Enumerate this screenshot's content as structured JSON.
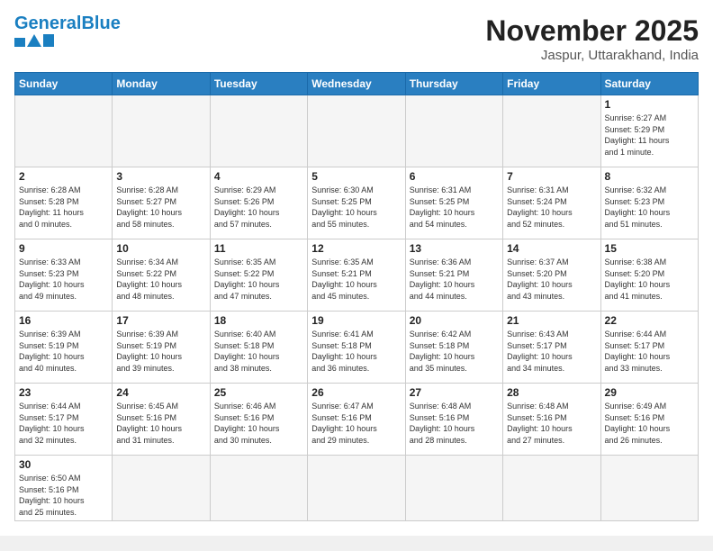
{
  "header": {
    "logo_general": "General",
    "logo_blue": "Blue",
    "title": "November 2025",
    "location": "Jaspur, Uttarakhand, India"
  },
  "weekdays": [
    "Sunday",
    "Monday",
    "Tuesday",
    "Wednesday",
    "Thursday",
    "Friday",
    "Saturday"
  ],
  "days": [
    {
      "num": "",
      "info": ""
    },
    {
      "num": "",
      "info": ""
    },
    {
      "num": "",
      "info": ""
    },
    {
      "num": "",
      "info": ""
    },
    {
      "num": "",
      "info": ""
    },
    {
      "num": "",
      "info": ""
    },
    {
      "num": "1",
      "info": "Sunrise: 6:27 AM\nSunset: 5:29 PM\nDaylight: 11 hours\nand 1 minute."
    },
    {
      "num": "2",
      "info": "Sunrise: 6:28 AM\nSunset: 5:28 PM\nDaylight: 11 hours\nand 0 minutes."
    },
    {
      "num": "3",
      "info": "Sunrise: 6:28 AM\nSunset: 5:27 PM\nDaylight: 10 hours\nand 58 minutes."
    },
    {
      "num": "4",
      "info": "Sunrise: 6:29 AM\nSunset: 5:26 PM\nDaylight: 10 hours\nand 57 minutes."
    },
    {
      "num": "5",
      "info": "Sunrise: 6:30 AM\nSunset: 5:25 PM\nDaylight: 10 hours\nand 55 minutes."
    },
    {
      "num": "6",
      "info": "Sunrise: 6:31 AM\nSunset: 5:25 PM\nDaylight: 10 hours\nand 54 minutes."
    },
    {
      "num": "7",
      "info": "Sunrise: 6:31 AM\nSunset: 5:24 PM\nDaylight: 10 hours\nand 52 minutes."
    },
    {
      "num": "8",
      "info": "Sunrise: 6:32 AM\nSunset: 5:23 PM\nDaylight: 10 hours\nand 51 minutes."
    },
    {
      "num": "9",
      "info": "Sunrise: 6:33 AM\nSunset: 5:23 PM\nDaylight: 10 hours\nand 49 minutes."
    },
    {
      "num": "10",
      "info": "Sunrise: 6:34 AM\nSunset: 5:22 PM\nDaylight: 10 hours\nand 48 minutes."
    },
    {
      "num": "11",
      "info": "Sunrise: 6:35 AM\nSunset: 5:22 PM\nDaylight: 10 hours\nand 47 minutes."
    },
    {
      "num": "12",
      "info": "Sunrise: 6:35 AM\nSunset: 5:21 PM\nDaylight: 10 hours\nand 45 minutes."
    },
    {
      "num": "13",
      "info": "Sunrise: 6:36 AM\nSunset: 5:21 PM\nDaylight: 10 hours\nand 44 minutes."
    },
    {
      "num": "14",
      "info": "Sunrise: 6:37 AM\nSunset: 5:20 PM\nDaylight: 10 hours\nand 43 minutes."
    },
    {
      "num": "15",
      "info": "Sunrise: 6:38 AM\nSunset: 5:20 PM\nDaylight: 10 hours\nand 41 minutes."
    },
    {
      "num": "16",
      "info": "Sunrise: 6:39 AM\nSunset: 5:19 PM\nDaylight: 10 hours\nand 40 minutes."
    },
    {
      "num": "17",
      "info": "Sunrise: 6:39 AM\nSunset: 5:19 PM\nDaylight: 10 hours\nand 39 minutes."
    },
    {
      "num": "18",
      "info": "Sunrise: 6:40 AM\nSunset: 5:18 PM\nDaylight: 10 hours\nand 38 minutes."
    },
    {
      "num": "19",
      "info": "Sunrise: 6:41 AM\nSunset: 5:18 PM\nDaylight: 10 hours\nand 36 minutes."
    },
    {
      "num": "20",
      "info": "Sunrise: 6:42 AM\nSunset: 5:18 PM\nDaylight: 10 hours\nand 35 minutes."
    },
    {
      "num": "21",
      "info": "Sunrise: 6:43 AM\nSunset: 5:17 PM\nDaylight: 10 hours\nand 34 minutes."
    },
    {
      "num": "22",
      "info": "Sunrise: 6:44 AM\nSunset: 5:17 PM\nDaylight: 10 hours\nand 33 minutes."
    },
    {
      "num": "23",
      "info": "Sunrise: 6:44 AM\nSunset: 5:17 PM\nDaylight: 10 hours\nand 32 minutes."
    },
    {
      "num": "24",
      "info": "Sunrise: 6:45 AM\nSunset: 5:16 PM\nDaylight: 10 hours\nand 31 minutes."
    },
    {
      "num": "25",
      "info": "Sunrise: 6:46 AM\nSunset: 5:16 PM\nDaylight: 10 hours\nand 30 minutes."
    },
    {
      "num": "26",
      "info": "Sunrise: 6:47 AM\nSunset: 5:16 PM\nDaylight: 10 hours\nand 29 minutes."
    },
    {
      "num": "27",
      "info": "Sunrise: 6:48 AM\nSunset: 5:16 PM\nDaylight: 10 hours\nand 28 minutes."
    },
    {
      "num": "28",
      "info": "Sunrise: 6:48 AM\nSunset: 5:16 PM\nDaylight: 10 hours\nand 27 minutes."
    },
    {
      "num": "29",
      "info": "Sunrise: 6:49 AM\nSunset: 5:16 PM\nDaylight: 10 hours\nand 26 minutes."
    },
    {
      "num": "30",
      "info": "Sunrise: 6:50 AM\nSunset: 5:16 PM\nDaylight: 10 hours\nand 25 minutes."
    }
  ]
}
